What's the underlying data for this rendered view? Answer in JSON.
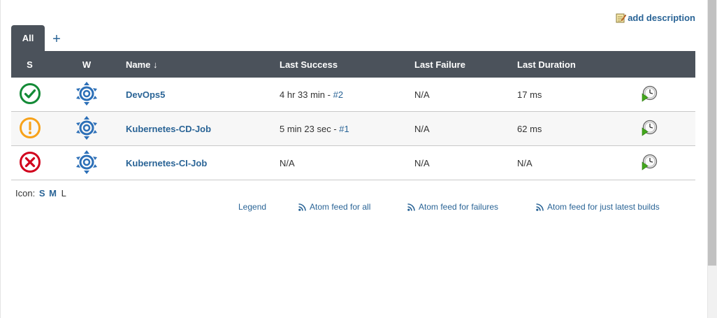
{
  "header": {
    "add_description": "add description"
  },
  "tabs": [
    {
      "label": "All",
      "active": true
    }
  ],
  "tab_add_label": "+",
  "table": {
    "columns": {
      "s": "S",
      "w": "W",
      "name": "Name ↓",
      "last_success": "Last Success",
      "last_failure": "Last Failure",
      "last_duration": "Last Duration"
    },
    "rows": [
      {
        "status": "success",
        "weather": "sunny",
        "name": "DevOps5",
        "last_success_text": "4 hr 33 min - ",
        "last_success_build": "#2",
        "last_failure": "N/A",
        "last_duration": "17 ms"
      },
      {
        "status": "unstable",
        "weather": "sunny",
        "name": "Kubernetes-CD-Job",
        "last_success_text": "5 min 23 sec - ",
        "last_success_build": "#1",
        "last_failure": "N/A",
        "last_duration": "62 ms"
      },
      {
        "status": "failed",
        "weather": "sunny",
        "name": "Kubernetes-CI-Job",
        "last_success_text": "N/A",
        "last_success_build": "",
        "last_failure": "N/A",
        "last_duration": "N/A"
      }
    ]
  },
  "icon_size": {
    "label": "Icon:",
    "options": [
      "S",
      "M",
      "L"
    ],
    "selected": "L"
  },
  "footer": {
    "legend": "Legend",
    "atom_all": "Atom feed for all",
    "atom_failures": "Atom feed for failures",
    "atom_latest": "Atom feed for just latest builds"
  },
  "colors": {
    "header_bg": "#4b525b",
    "link": "#2a6496",
    "success": "#138a36",
    "unstable": "#f7a21a",
    "failed": "#d1001c",
    "weather": "#2c6fb7"
  }
}
